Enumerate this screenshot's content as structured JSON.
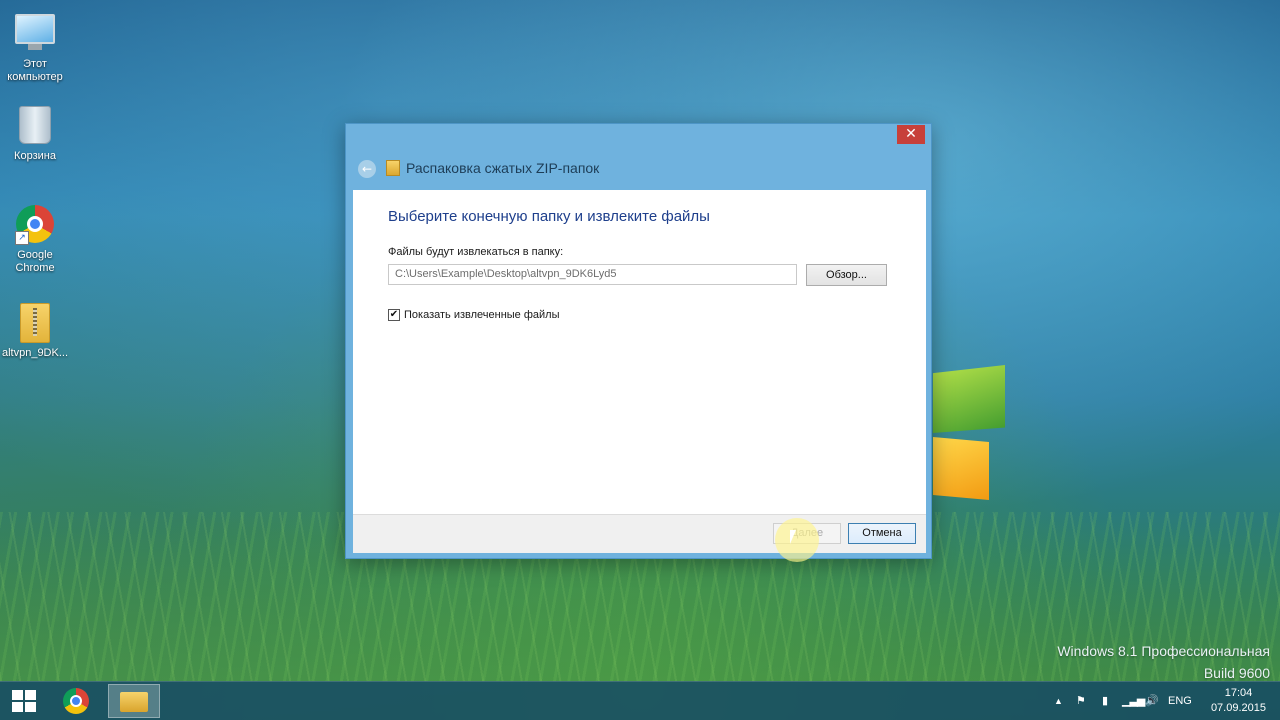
{
  "desktop": {
    "icons": [
      {
        "label_line1": "Этот",
        "label_line2": "компьютер",
        "icon": "this-pc-icon"
      },
      {
        "label_line1": "Корзина",
        "label_line2": "",
        "icon": "recycle-bin-icon"
      },
      {
        "label_line1": "Google",
        "label_line2": "Chrome",
        "icon": "chrome-icon"
      },
      {
        "label_line1": "altvpn_9DK...",
        "label_line2": "",
        "icon": "zip-folder-icon"
      }
    ],
    "watermark": {
      "line1": "Windows 8.1 Профессиональная",
      "line2": "Build 9600"
    }
  },
  "dialog": {
    "title": "Распаковка сжатых ZIP-папок",
    "close_glyph": "✕",
    "back_glyph": "←",
    "heading": "Выберите конечную папку и извлеките файлы",
    "path_label": "Файлы будут извлекаться в папку:",
    "path_value": "C:\\Users\\Example\\Desktop\\altvpn_9DK6Lyd5",
    "browse_label": "Обзор...",
    "show_files_label": "Показать извлеченные файлы",
    "show_files_checked": true,
    "checkmark_glyph": "✔",
    "next_label": "Далее",
    "cancel_label": "Отмена"
  },
  "taskbar": {
    "tray": {
      "arrow": "▲",
      "lang": "ENG",
      "time": "17:04",
      "date": "07.09.2015"
    }
  },
  "colors": {
    "dialog_frame": "#6fb2de",
    "close_red": "#c7403a",
    "heading_blue": "#1e3f8c"
  }
}
